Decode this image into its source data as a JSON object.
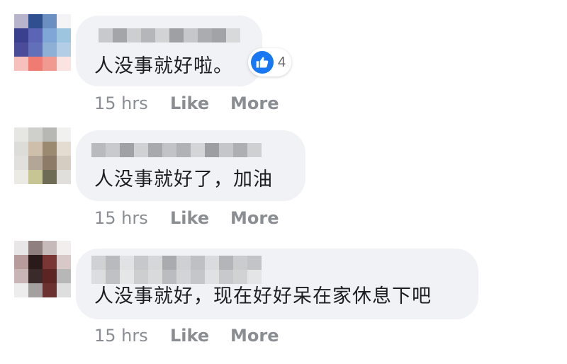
{
  "comments": [
    {
      "text": "人没事就好啦。",
      "time": "15 hrs",
      "like_label": "Like",
      "more_label": "More",
      "reaction_count": "4",
      "reaction_icon": "thumbs-up-icon"
    },
    {
      "text": "人没事就好了，加油",
      "time": "15 hrs",
      "like_label": "Like",
      "more_label": "More"
    },
    {
      "text": "人没事就好，现在好好呆在家休息下吧",
      "time": "15 hrs",
      "like_label": "Like",
      "more_label": "More"
    }
  ],
  "colors": {
    "bubble_bg": "#f0f2f5",
    "meta_text": "#8a8d91",
    "like_blue": "#1877f2"
  }
}
